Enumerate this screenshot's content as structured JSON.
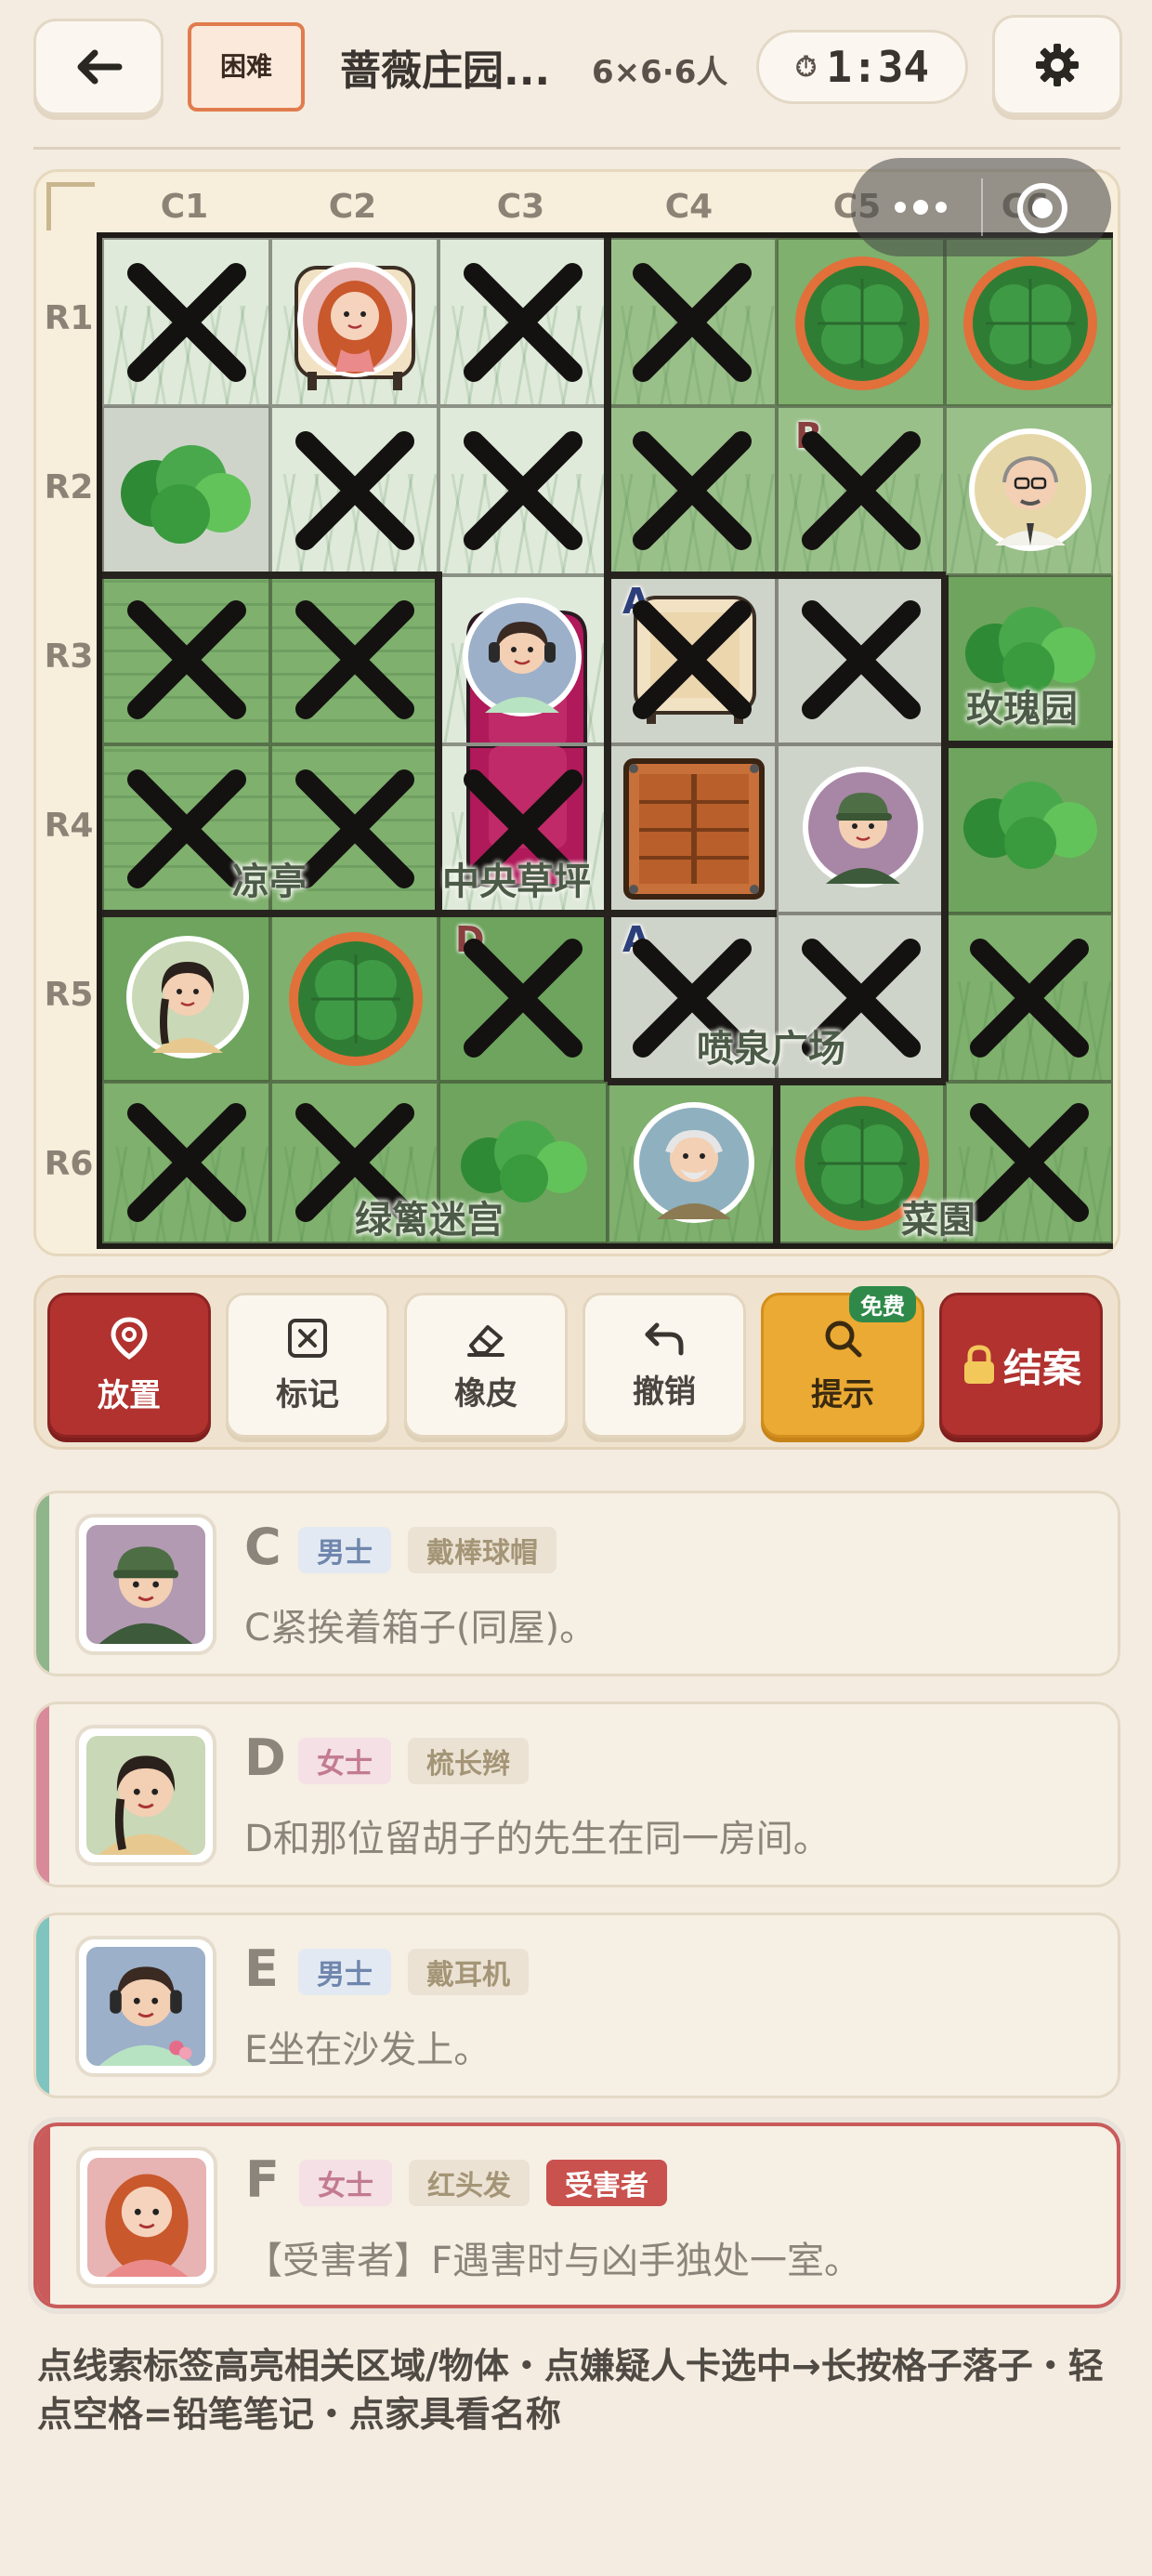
{
  "header": {
    "back_icon": "arrow-left-icon",
    "difficulty": "困难",
    "title": "蔷薇庄园...",
    "size_tag": "6×6·6人",
    "timer": "1:34",
    "settings_icon": "gear-icon"
  },
  "board": {
    "columns": [
      "C1",
      "C2",
      "C3",
      "C4",
      "C5",
      "C6"
    ],
    "rows": [
      "R1",
      "R2",
      "R3",
      "R4",
      "R5",
      "R6"
    ],
    "room_labels": {
      "pavilion": "凉亭",
      "central_lawn": "中央草坪",
      "rose_garden": "玫瑰园",
      "fountain_plaza": "喷泉广场",
      "maze": "绿篱迷宫",
      "vegetable_garden": "菜園"
    },
    "cell_marks": {
      "r2c5": "B",
      "r3c4": "A",
      "r5c3": "D",
      "r5c4": "A"
    }
  },
  "toolbar": {
    "place": "放置",
    "mark": "标记",
    "eraser": "橡皮",
    "undo": "撤销",
    "hint": "提示",
    "hint_badge": "免费",
    "close_case": "结案"
  },
  "suspects": [
    {
      "letter": "C",
      "gender": "男士",
      "trait": "戴棒球帽",
      "clue": "C紧挨着箱子(同屋)。",
      "stripe": "#8fb58a"
    },
    {
      "letter": "D",
      "gender": "女士",
      "trait": "梳长辫",
      "clue": "D和那位留胡子的先生在同一房间。",
      "stripe": "#d98a9a"
    },
    {
      "letter": "E",
      "gender": "男士",
      "trait": "戴耳机",
      "clue": "E坐在沙发上。",
      "stripe": "#7fc4bf"
    },
    {
      "letter": "F",
      "gender": "女士",
      "trait": "红头发",
      "victim": "受害者",
      "clue": "【受害者】F遇害时与凶手独处一室。",
      "stripe": "#c95b5b"
    }
  ],
  "footer": "点线索标签高亮相关区域/物体・点嫌疑人卡选中→长按格子落子・轻点空格=铅笔笔记・点家具看名称",
  "colors": {
    "accent_red": "#b1322f",
    "hint_yellow": "#ebaa33",
    "difficulty_orange": "#e07c4c"
  }
}
